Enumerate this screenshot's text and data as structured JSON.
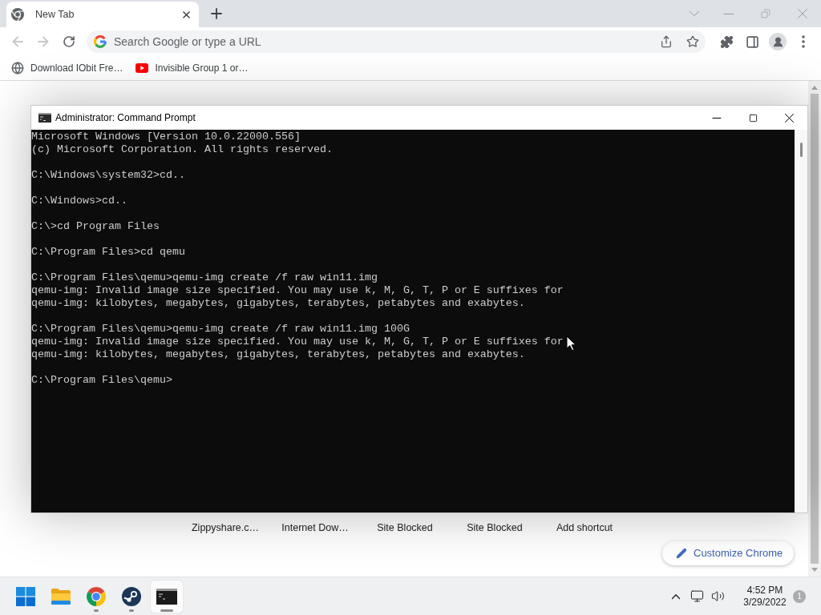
{
  "browser": {
    "tabs": [
      {
        "title": "New Tab",
        "selected": true
      }
    ],
    "omnibox": {
      "placeholder": "Search Google or type a URL"
    },
    "bookmarks": [
      {
        "label": "Download IObit Fre…",
        "kind": "globe"
      },
      {
        "label": "Invisible Group 1 or…",
        "kind": "youtube"
      }
    ],
    "shortcuts": [
      {
        "label": "Zippyshare.c…"
      },
      {
        "label": "Internet Dow…"
      },
      {
        "label": "Site Blocked"
      },
      {
        "label": "Site Blocked"
      },
      {
        "label": "Add shortcut"
      }
    ],
    "customize_button": {
      "label": "Customize Chrome"
    }
  },
  "console_window": {
    "title": "Administrator: Command Prompt",
    "blocks": [
      [
        "Microsoft Windows [Version 10.0.22000.556]",
        "(c) Microsoft Corporation. All rights reserved."
      ],
      [
        "C:\\Windows\\system32>cd.."
      ],
      [
        "C:\\Windows>cd.."
      ],
      [
        "C:\\>cd Program Files"
      ],
      [
        "C:\\Program Files>cd qemu"
      ],
      [
        "C:\\Program Files\\qemu>qemu-img create /f raw win11.img",
        "qemu-img: Invalid image size specified. You may use k, M, G, T, P or E suffixes for",
        "qemu-img: kilobytes, megabytes, gigabytes, terabytes, petabytes and exabytes."
      ],
      [
        "C:\\Program Files\\qemu>qemu-img create /f raw win11.img 100G",
        "qemu-img: Invalid image size specified. You may use k, M, G, T, P or E suffixes for",
        "qemu-img: kilobytes, megabytes, gigabytes, terabytes, petabytes and exabytes."
      ],
      [
        "C:\\Program Files\\qemu>"
      ]
    ]
  },
  "taskbar": {
    "apps": [
      {
        "kind": "start",
        "running": false,
        "selected": false
      },
      {
        "kind": "explorer",
        "running": false,
        "selected": false
      },
      {
        "kind": "chrome",
        "running": true,
        "selected": false
      },
      {
        "kind": "steam",
        "running": true,
        "selected": false
      },
      {
        "kind": "console",
        "running": true,
        "selected": true
      }
    ],
    "clock": {
      "time": "4:52 PM",
      "date": "3/29/2022"
    },
    "notifications": {
      "count": "1"
    }
  }
}
